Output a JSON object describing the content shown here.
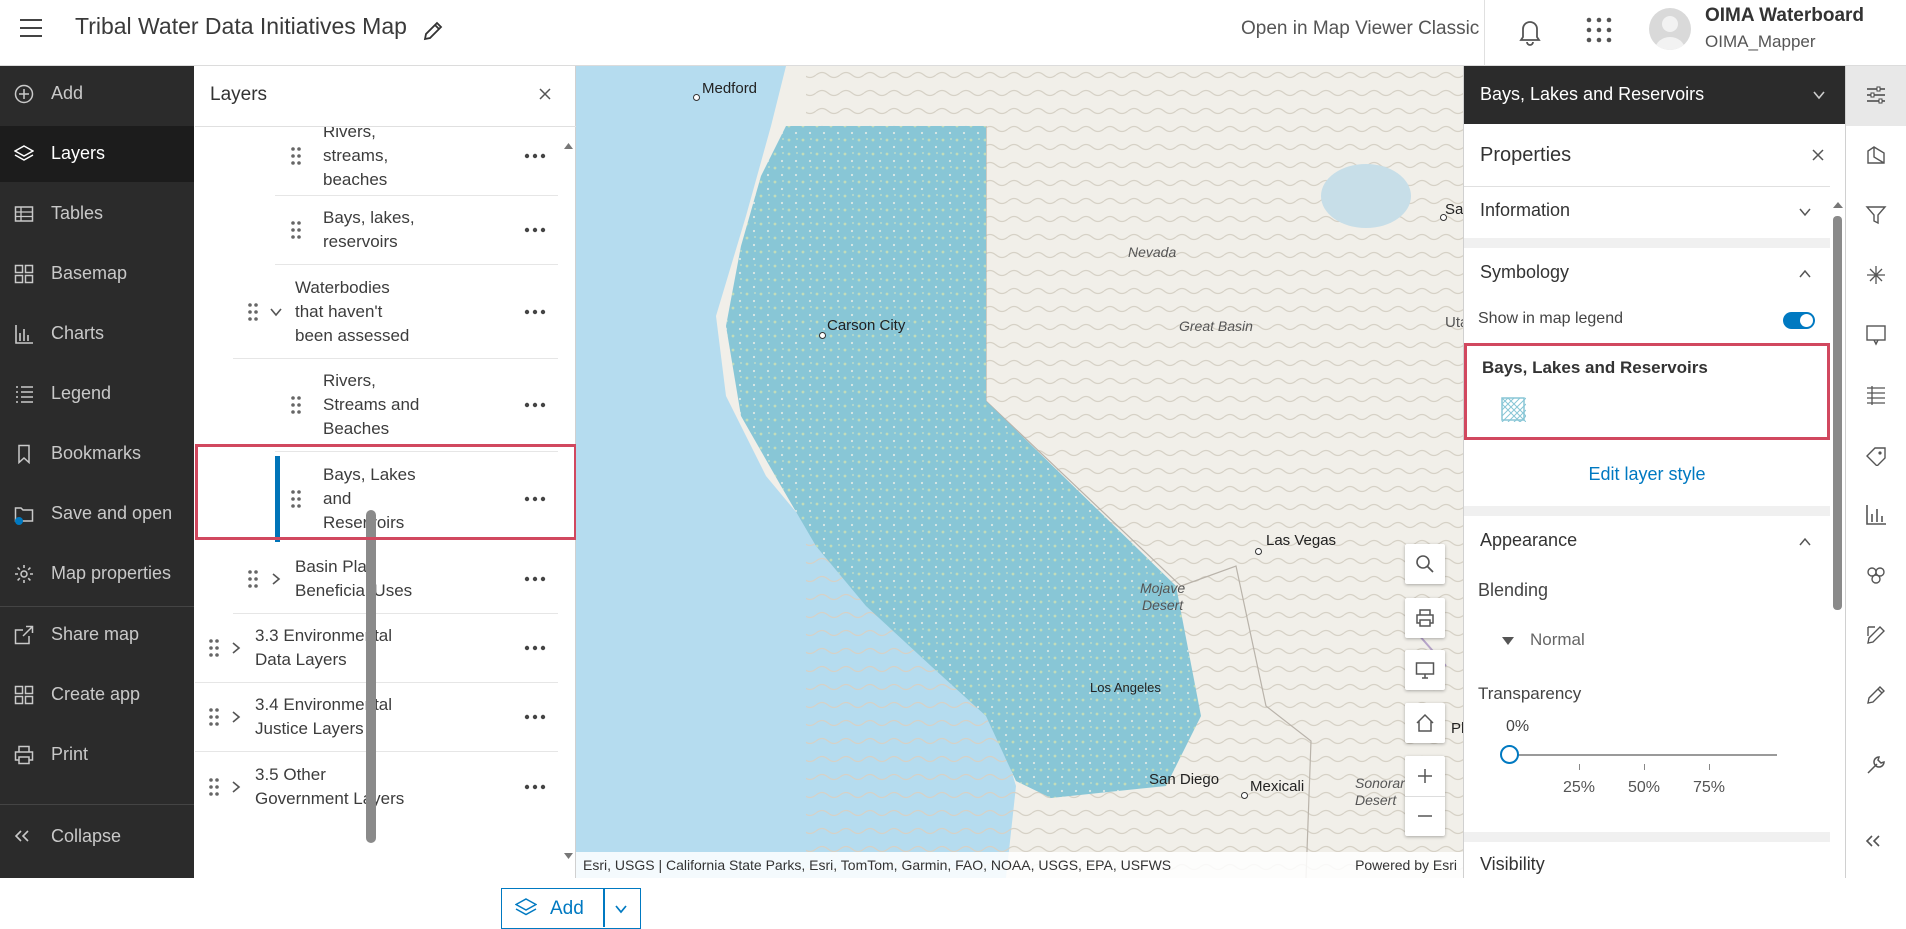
{
  "header": {
    "title": "Tribal Water Data Initiatives Map",
    "classic_link": "Open in Map Viewer Classic",
    "org_name": "OIMA Waterboard",
    "username": "OIMA_Mapper"
  },
  "left_nav": {
    "items": [
      {
        "label": "Add",
        "icon": "add-circle-icon"
      },
      {
        "label": "Layers",
        "icon": "layers-icon",
        "active": true
      },
      {
        "label": "Tables",
        "icon": "table-icon"
      },
      {
        "label": "Basemap",
        "icon": "basemap-icon"
      },
      {
        "label": "Charts",
        "icon": "chart-icon"
      },
      {
        "label": "Legend",
        "icon": "legend-icon"
      },
      {
        "label": "Bookmarks",
        "icon": "bookmark-icon"
      },
      {
        "label": "Save and open",
        "icon": "save-icon"
      },
      {
        "label": "Map properties",
        "icon": "gear-icon"
      },
      {
        "label": "Share map",
        "icon": "share-icon"
      },
      {
        "label": "Create app",
        "icon": "create-app-icon"
      },
      {
        "label": "Print",
        "icon": "print-icon"
      }
    ],
    "collapse_label": "Collapse"
  },
  "layers_panel": {
    "title": "Layers",
    "rows": [
      {
        "text": "Rivers,\nstreams,\nbeaches"
      },
      {
        "text": "Bays, lakes,\nreservoirs"
      },
      {
        "text": "Waterbodies\nthat haven't\nbeen assessed"
      },
      {
        "text": "Rivers,\nStreams and\nBeaches"
      },
      {
        "text": "Bays, Lakes\nand\nReservoirs",
        "selected": true
      },
      {
        "text": "Basin Plan\nBeneficial Uses"
      },
      {
        "text": "3.3 Environmental\nData Layers"
      },
      {
        "text": "3.4 Environmental\nJustice Layers"
      },
      {
        "text": "3.5 Other\nGovernment Layers"
      }
    ],
    "add_button": "Add"
  },
  "map": {
    "cities": [
      "Medford",
      "Carson City",
      "Las Vegas",
      "Mexicali",
      "Sa",
      "Uta",
      "Phc",
      "Los Angeles",
      "San Diego"
    ],
    "regions": [
      "Nevada",
      "Great Basin",
      "Mojave\nDesert",
      "Sonorar\nDesert"
    ],
    "attribution": "Esri, USGS | California State Parks, Esri, TomTom, Garmin, FAO, NOAA, USGS, EPA, USFWS",
    "powered_by": "Powered by Esri",
    "colors": {
      "water_layer": "#88c6d6",
      "land": "#f1efe9",
      "ocean": "#b5dcef"
    }
  },
  "properties_panel": {
    "layer_title": "Bays, Lakes and Reservoirs",
    "title": "Properties",
    "sections": {
      "information": "Information",
      "symbology": "Symbology",
      "appearance": "Appearance",
      "visibility": "Visibility"
    },
    "show_in_legend": "Show in map legend",
    "show_in_legend_on": true,
    "symbol_title": "Bays, Lakes and Reservoirs",
    "edit_style": "Edit layer style",
    "blending_label": "Blending",
    "blending_value": "Normal",
    "transparency_label": "Transparency",
    "transparency_value": "0%",
    "transparency_fraction": 0,
    "tick_labels": [
      "25%",
      "50%",
      "75%"
    ],
    "accent_color": "#0079c1",
    "highlight_color": "#d1485f"
  }
}
